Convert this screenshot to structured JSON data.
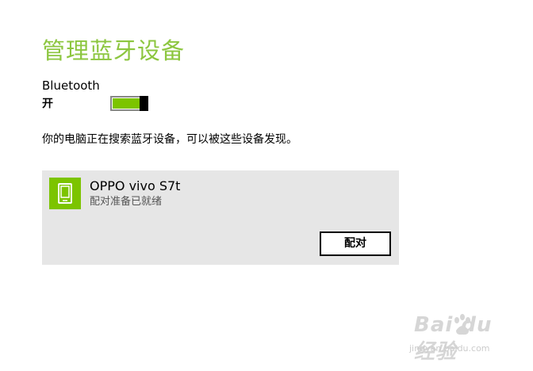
{
  "page": {
    "title": "管理蓝牙设备"
  },
  "bluetooth": {
    "label": "Bluetooth",
    "state": "开",
    "enabled": true
  },
  "status_text": "你的电脑正在搜索蓝牙设备，可以被这些设备发现。",
  "device": {
    "name": "OPPO vivo S7t",
    "status": "配对准备已就绪",
    "icon": "phone-icon",
    "pair_label": "配对"
  },
  "watermark": {
    "logo": "Bai du 经验",
    "url": "jingyan.baidu.com"
  },
  "colors": {
    "accent": "#8cc63f",
    "toggle_on": "#7cc400",
    "panel_bg": "#e6e6e6"
  }
}
